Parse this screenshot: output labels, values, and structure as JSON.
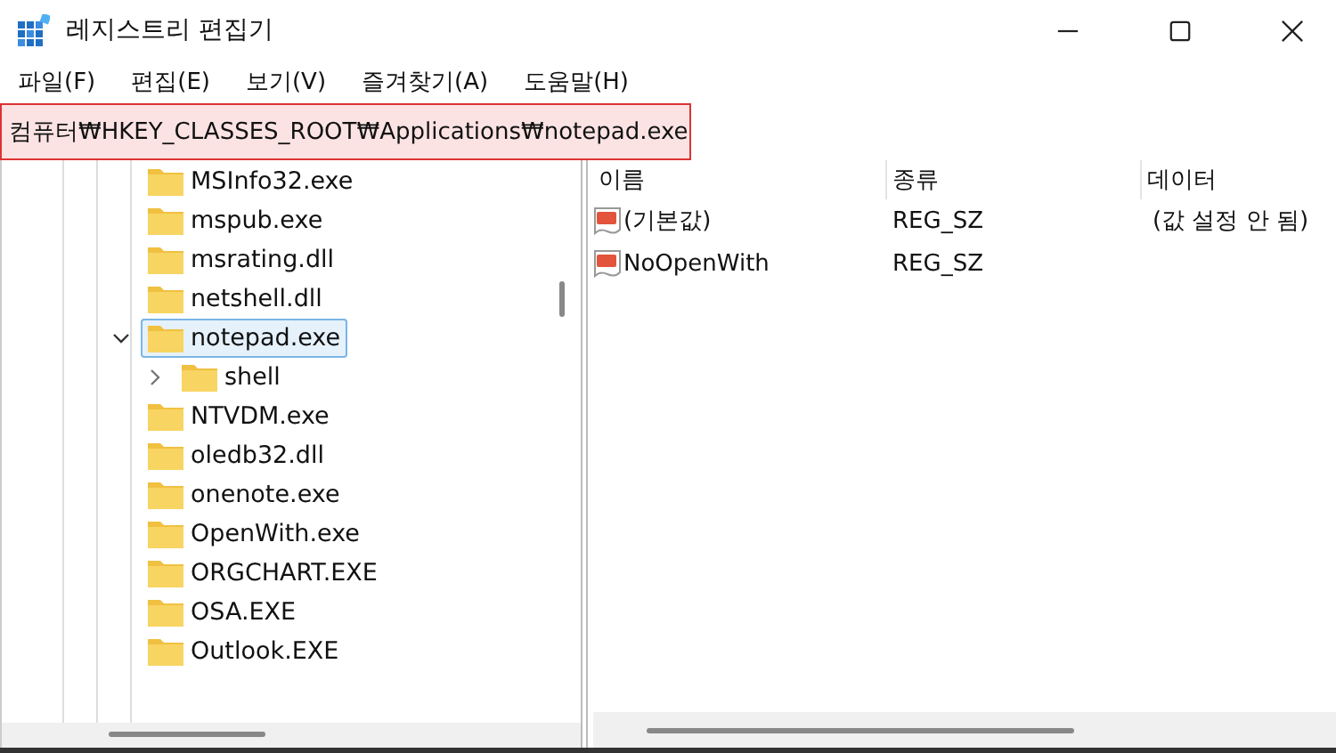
{
  "window": {
    "title": "레지스트리 편집기"
  },
  "menu": [
    "파일(F)",
    "편집(E)",
    "보기(V)",
    "즐겨찾기(A)",
    "도움말(H)"
  ],
  "address_bar": {
    "value": "컴퓨터₩HKEY_CLASSES_ROOT₩Applications₩notepad.exe",
    "highlighted": true
  },
  "tree": [
    {
      "label": "MSInfo32.exe",
      "selected": false
    },
    {
      "label": "mspub.exe",
      "selected": false
    },
    {
      "label": "msrating.dll",
      "selected": false
    },
    {
      "label": "netshell.dll",
      "selected": false
    },
    {
      "label": "notepad.exe",
      "selected": true,
      "expanded": true,
      "children": [
        {
          "label": "shell",
          "selected": false,
          "expanded": false
        }
      ]
    },
    {
      "label": "NTVDM.exe",
      "selected": false
    },
    {
      "label": "oledb32.dll",
      "selected": false
    },
    {
      "label": "onenote.exe",
      "selected": false
    },
    {
      "label": "OpenWith.exe",
      "selected": false
    },
    {
      "label": "ORGCHART.EXE",
      "selected": false
    },
    {
      "label": "OSA.EXE",
      "selected": false
    },
    {
      "label": "Outlook.EXE",
      "selected": false
    }
  ],
  "values_table": {
    "columns": [
      "이름",
      "종류",
      "데이터"
    ],
    "rows": [
      {
        "name": "(기본값)",
        "type": "REG_SZ",
        "data": "(값 설정 안 됨)"
      },
      {
        "name": "NoOpenWith",
        "type": "REG_SZ"
      }
    ]
  }
}
